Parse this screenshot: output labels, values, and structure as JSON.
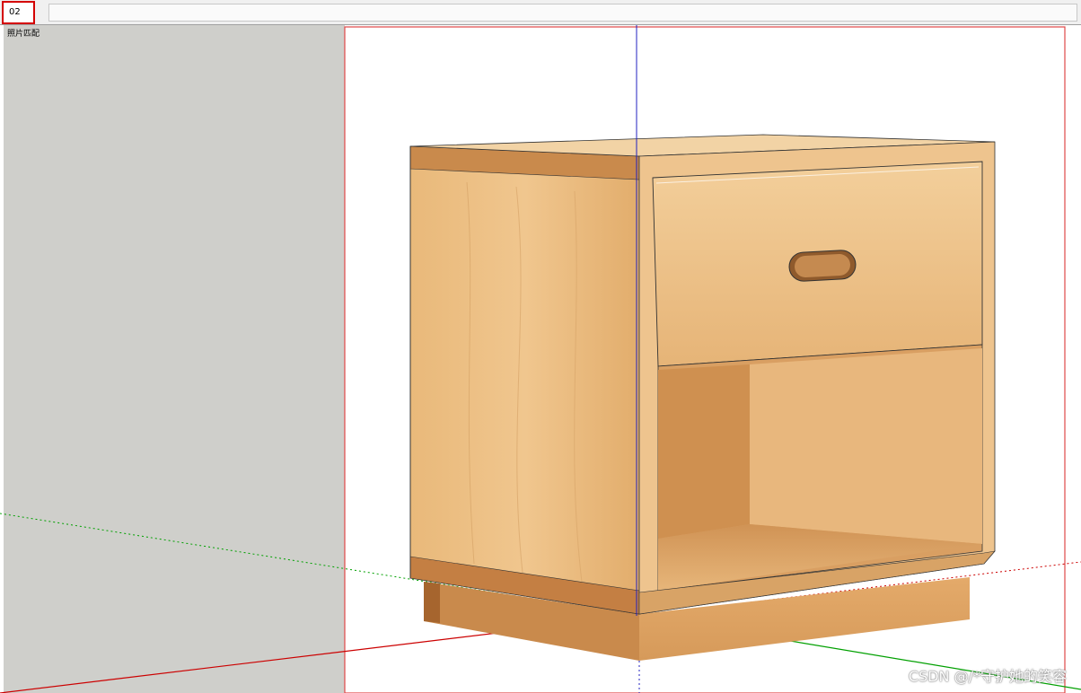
{
  "tabs": [
    {
      "label": "02"
    }
  ],
  "viewport": {
    "label": "照片匹配"
  },
  "watermark": "CSDN @/*守护她的笑容",
  "colors": {
    "axis_red": "#cc0000",
    "axis_green": "#00a000",
    "axis_blue": "#2020c0",
    "wood_light": "#e8b97c",
    "wood_mid": "#d9a160",
    "wood_dark": "#b8753a"
  }
}
